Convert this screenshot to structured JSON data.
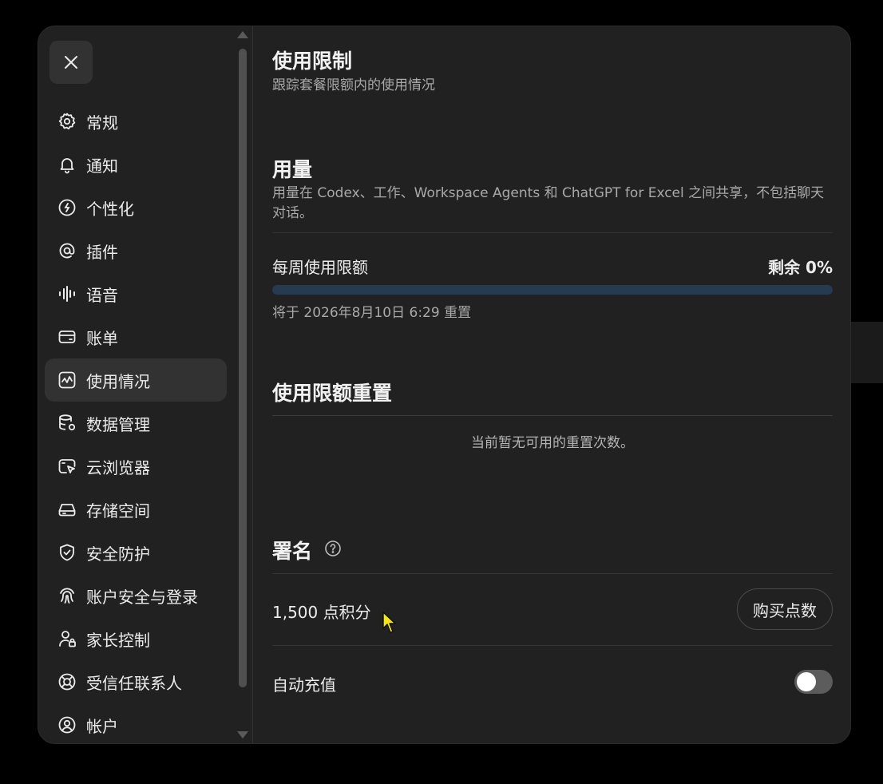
{
  "sidebar": {
    "items": [
      {
        "label": "常规",
        "icon": "gear-icon",
        "active": false
      },
      {
        "label": "通知",
        "icon": "bell-icon",
        "active": false
      },
      {
        "label": "个性化",
        "icon": "personalization-icon",
        "active": false
      },
      {
        "label": "插件",
        "icon": "at-sign-icon",
        "active": false
      },
      {
        "label": "语音",
        "icon": "waveform-icon",
        "active": false
      },
      {
        "label": "账单",
        "icon": "credit-card-icon",
        "active": false
      },
      {
        "label": "使用情况",
        "icon": "activity-chart-icon",
        "active": true
      },
      {
        "label": "数据管理",
        "icon": "database-gear-icon",
        "active": false
      },
      {
        "label": "云浏览器",
        "icon": "cloud-browser-icon",
        "active": false
      },
      {
        "label": "存储空间",
        "icon": "storage-drive-icon",
        "active": false
      },
      {
        "label": "安全防护",
        "icon": "shield-check-icon",
        "active": false
      },
      {
        "label": "账户安全与登录",
        "icon": "fingerprint-icon",
        "active": false
      },
      {
        "label": "家长控制",
        "icon": "user-lock-icon",
        "active": false
      },
      {
        "label": "受信任联系人",
        "icon": "lifebuoy-icon",
        "active": false
      },
      {
        "label": "帐户",
        "icon": "user-circle-icon",
        "active": false
      }
    ]
  },
  "main": {
    "title": "使用限制",
    "subtitle": "跟踪套餐限额内的使用情况",
    "usage": {
      "heading": "用量",
      "description": "用量在 Codex、工作、Workspace Agents 和 ChatGPT for Excel 之间共享，不包括聊天对话。",
      "weekly_label": "每周使用限额",
      "remaining": "剩余 0%",
      "used_fraction": 0,
      "reset_text": "将于 2026年8月10日 6:29 重置"
    },
    "reset": {
      "heading": "使用限额重置",
      "empty_text": "当前暂无可用的重置次数。"
    },
    "credits": {
      "heading": "署名",
      "amount": "1,500 点积分",
      "buy_label": "购买点数",
      "auto_topup_label": "自动充值",
      "auto_topup_on": false
    }
  },
  "colors": {
    "background": "#212121",
    "progress_track": "#263a52",
    "accent": "#4aa3ff"
  }
}
